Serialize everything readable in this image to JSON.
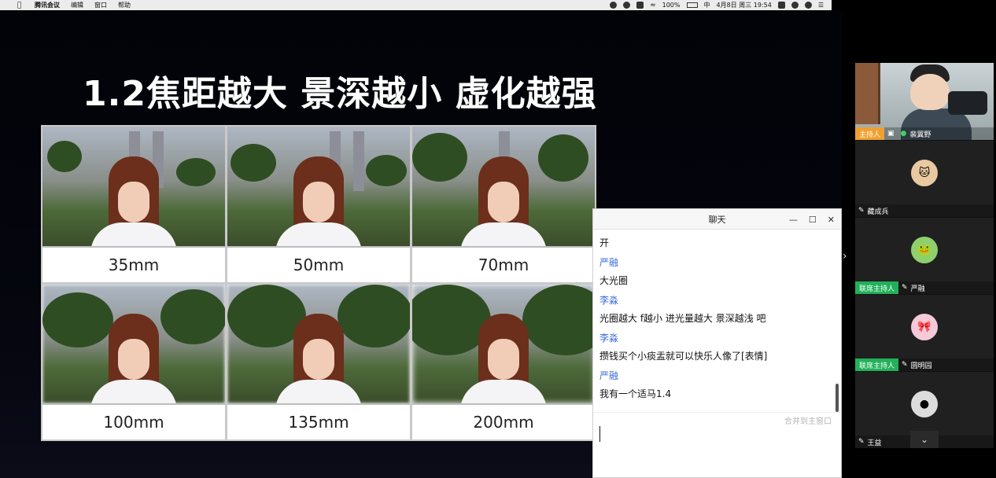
{
  "menubar": {
    "apple": "",
    "app_name": "腾讯会议",
    "menus": [
      "编辑",
      "窗口",
      "帮助"
    ],
    "battery": "100%",
    "datetime": "4月8日 周三  19:54"
  },
  "slide": {
    "title": "1.2焦距越大 景深越小 虚化越强",
    "labels": [
      "35mm",
      "50mm",
      "70mm",
      "100mm",
      "135mm",
      "200mm"
    ]
  },
  "chat": {
    "title": "聊天",
    "first_line": "开",
    "messages": [
      {
        "sender": "严融",
        "text": "大光圈"
      },
      {
        "sender": "李淼",
        "text": "光圈越大 f越小 进光量越大 景深越浅 吧"
      },
      {
        "sender": "李淼",
        "text": "攒钱买个小痰盂就可以快乐人像了[表情]"
      },
      {
        "sender": "严融",
        "text": "我有一个适马1.4"
      }
    ],
    "merge_label": "合并到主窗口",
    "window_buttons": [
      "—",
      "☐",
      "✕"
    ]
  },
  "participants": [
    {
      "role": "主持人",
      "name": "裴翼野",
      "type": "video"
    },
    {
      "role": "",
      "name": "藏成兵",
      "type": "avatar",
      "avatar_color": "#e8c9a0",
      "avatar_icon": "cat-avatar"
    },
    {
      "role": "联席主持人",
      "name": "严融",
      "type": "avatar",
      "avatar_color": "#8fd06c",
      "avatar_icon": "cartoon-avatar"
    },
    {
      "role": "联席主持人",
      "name": "圆明园",
      "type": "avatar",
      "avatar_color": "#f6c9d8",
      "avatar_icon": "doll-avatar"
    },
    {
      "role": "",
      "name": "王益",
      "type": "avatar",
      "avatar_color": "#dcdcdc",
      "avatar_icon": "default-avatar"
    }
  ],
  "collapse_icon": "chevron-down-icon",
  "side_toggle": "›"
}
